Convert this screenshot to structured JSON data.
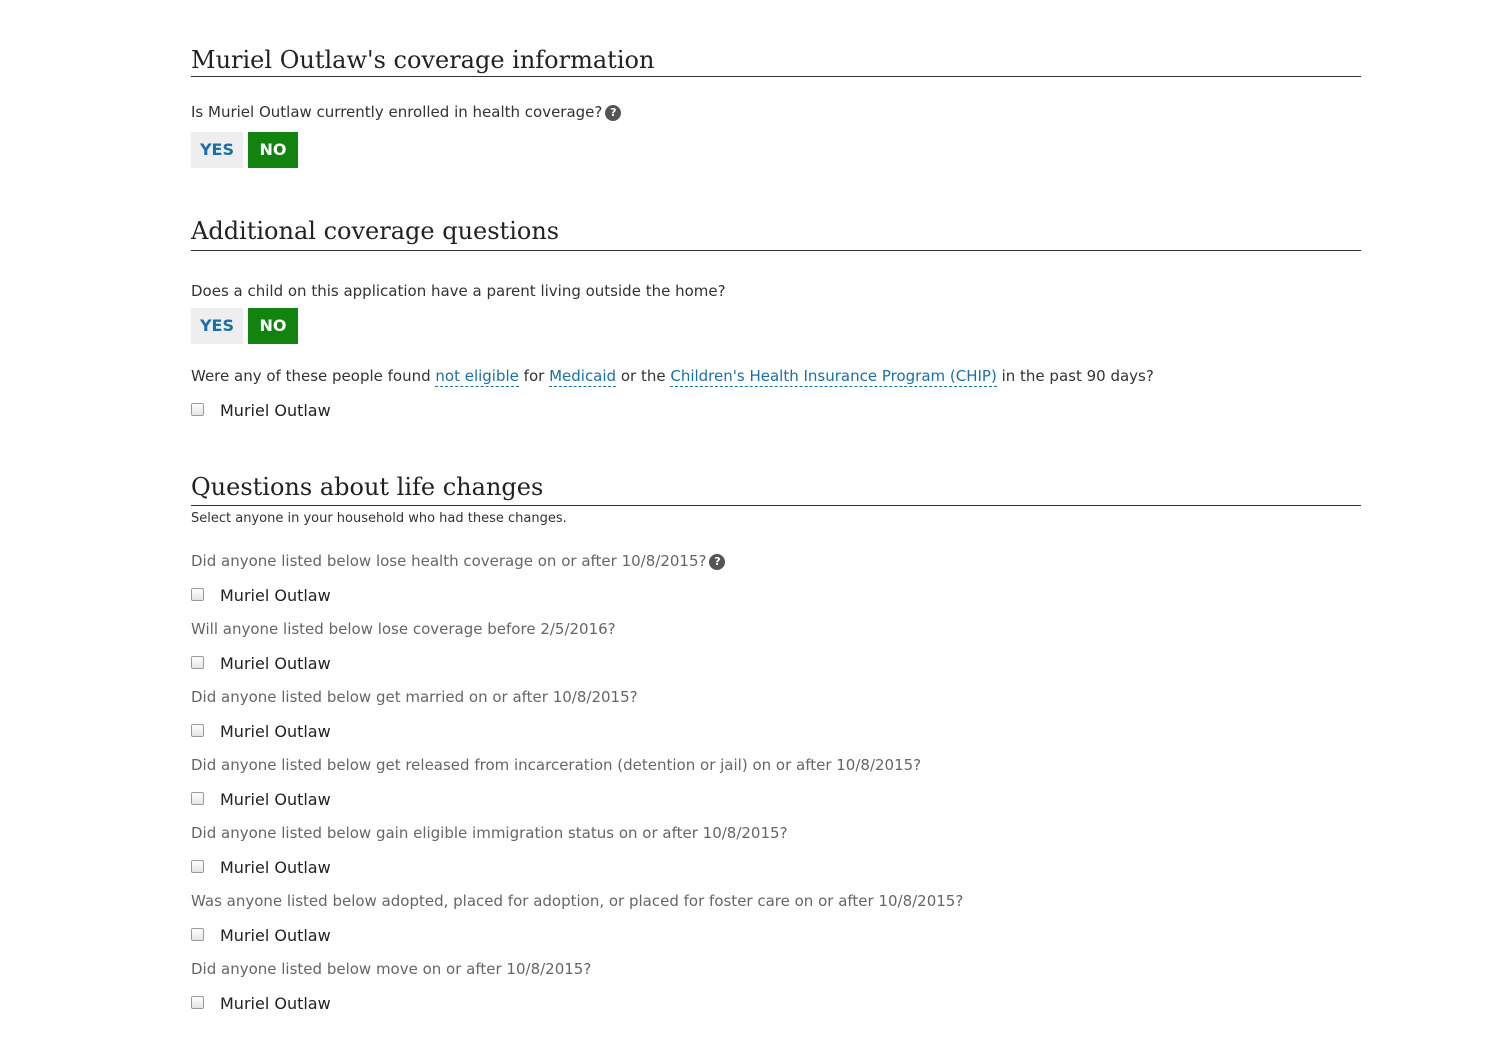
{
  "coverage_section": {
    "title": "Muriel Outlaw's coverage information",
    "question": "Is Muriel Outlaw currently enrolled in health coverage?",
    "yes_label": "YES",
    "no_label": "NO",
    "selected": "NO"
  },
  "additional_section": {
    "title": "Additional coverage questions",
    "parent_question": "Does a child on this application have a parent living outside the home?",
    "yes_label": "YES",
    "no_label": "NO",
    "selected": "NO",
    "eligibility_question": {
      "part1": "Were any of these people found ",
      "term1": "not eligible",
      "part2": " for ",
      "term2": "Medicaid",
      "part3": " or the ",
      "term3": "Children's Health Insurance Program (CHIP)",
      "part4": " in the past 90 days?"
    },
    "person": "Muriel Outlaw"
  },
  "life_changes_section": {
    "title": "Questions about life changes",
    "subtitle": "Select anyone in your household who had these changes.",
    "questions": [
      {
        "text": "Did anyone listed below lose health coverage on or after 10/8/2015?",
        "person": "Muriel Outlaw",
        "checked": false
      },
      {
        "text": "Will anyone listed below lose coverage before 2/5/2016?",
        "person": "Muriel Outlaw",
        "checked": false
      },
      {
        "text": "Did anyone listed below get married on or after 10/8/2015?",
        "person": "Muriel Outlaw",
        "checked": false
      },
      {
        "text": "Did anyone listed below get released from incarceration (detention or jail) on or after 10/8/2015?",
        "person": "Muriel Outlaw",
        "checked": false
      },
      {
        "text": "Did anyone listed below gain eligible immigration status on or after 10/8/2015?",
        "person": "Muriel Outlaw",
        "checked": false
      },
      {
        "text": "Was anyone listed below adopted, placed for adoption, or placed for foster care on or after 10/8/2015?",
        "person": "Muriel Outlaw",
        "checked": false
      },
      {
        "text": "Did anyone listed below move on or after 10/8/2015?",
        "person": "Muriel Outlaw",
        "checked": false
      }
    ]
  },
  "icons": {
    "help": "question-circle-icon"
  }
}
